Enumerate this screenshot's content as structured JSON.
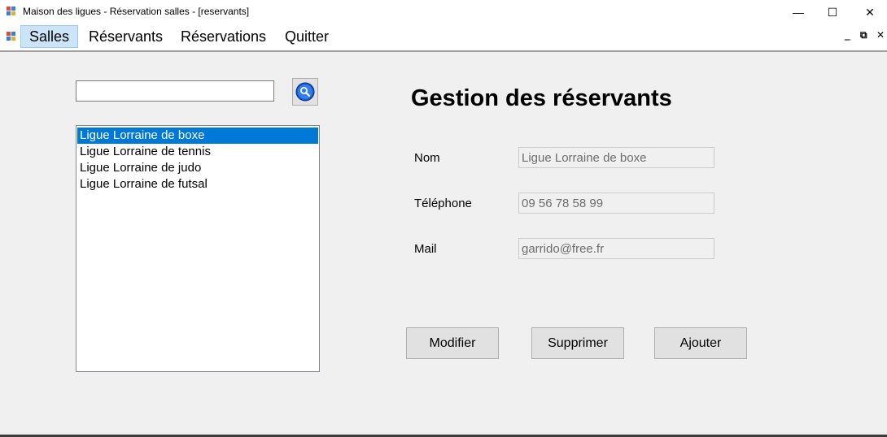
{
  "window": {
    "title": "Maison des ligues - Réservation salles - [reservants]",
    "minimize_glyph": "—",
    "maximize_glyph": "☐",
    "close_glyph": "✕",
    "mdi_minimize_glyph": "‗",
    "mdi_restore_glyph": "⧉",
    "mdi_close_glyph": "✕"
  },
  "menu": {
    "items": [
      {
        "label": "Salles",
        "active": true
      },
      {
        "label": "Réservants"
      },
      {
        "label": "Réservations"
      },
      {
        "label": "Quitter"
      }
    ]
  },
  "search": {
    "value": "",
    "button_icon": "magnifier-icon"
  },
  "list": {
    "items": [
      "Ligue Lorraine de boxe",
      "Ligue Lorraine de tennis",
      "Ligue Lorraine de judo",
      "Ligue Lorraine de futsal"
    ],
    "selected_index": 0
  },
  "form": {
    "title": "Gestion des réservants",
    "nom_label": "Nom",
    "nom_value": "Ligue Lorraine de boxe",
    "telephone_label": "Téléphone",
    "telephone_value": "09 56 78 58 99",
    "mail_label": "Mail",
    "mail_value": "garrido@free.fr"
  },
  "actions": {
    "modifier": "Modifier",
    "supprimer": "Supprimer",
    "ajouter": "Ajouter"
  },
  "colors": {
    "selection": "#0078d7",
    "menu_active": "#cce4f7",
    "background": "#f0f0f0"
  }
}
